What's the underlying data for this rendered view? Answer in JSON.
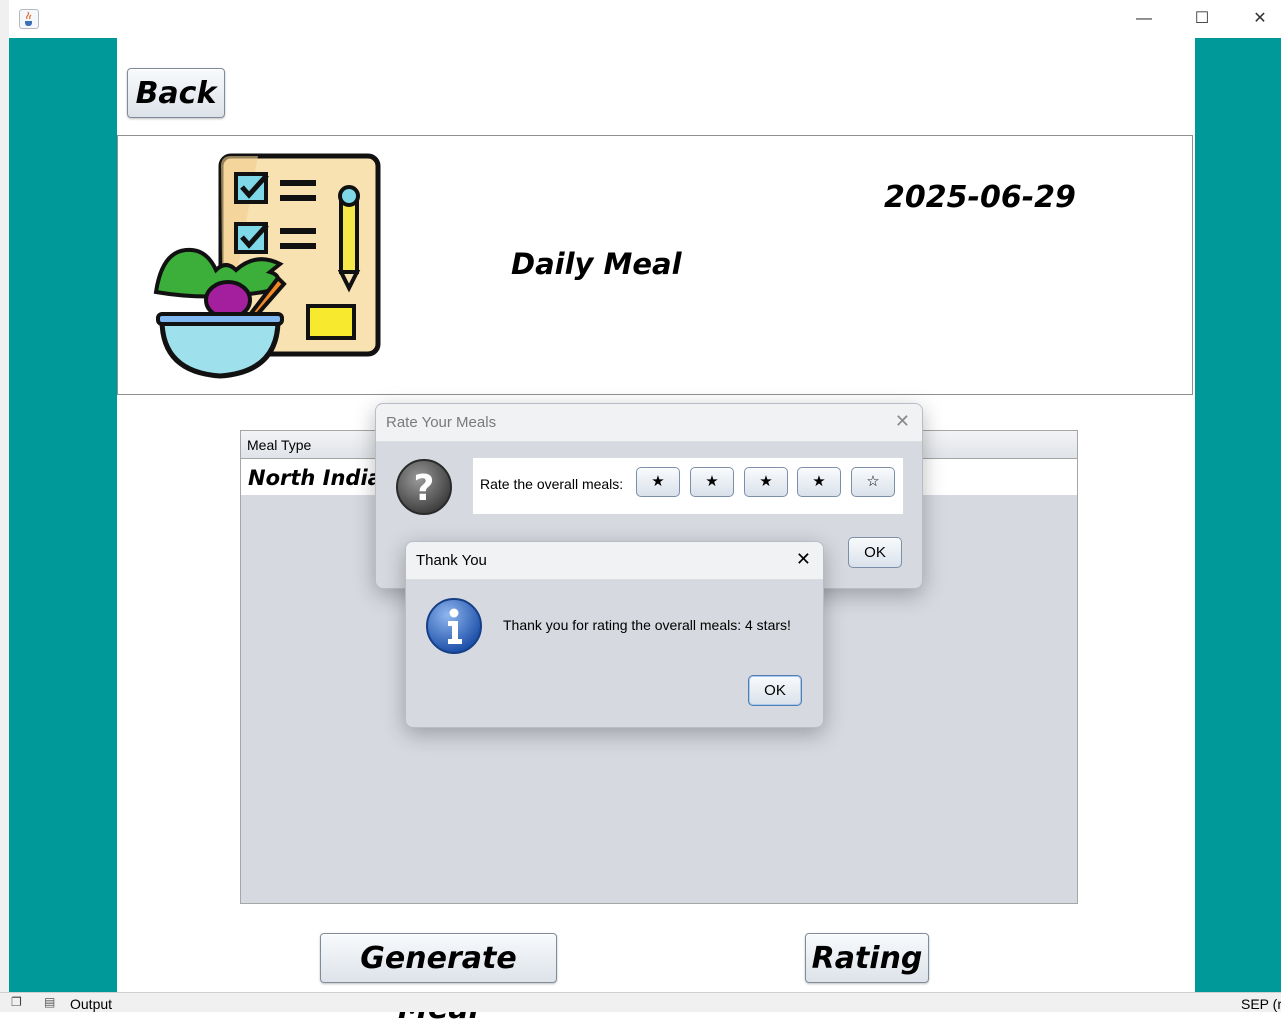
{
  "window": {
    "app_icon": "java-cup-icon",
    "controls": {
      "minimize": "—",
      "maximize": "☐",
      "close": "✕"
    }
  },
  "main": {
    "back_label": "Back",
    "title": "Daily Meal",
    "date": "2025-06-29",
    "logo_icon": "meal-checklist-icon",
    "table": {
      "columns": [
        "Meal Type"
      ],
      "rows": [
        [
          "North Indian"
        ]
      ]
    },
    "generate_label": "Generate Meal",
    "rating_label": "Rating"
  },
  "rate_dialog": {
    "title": "Rate Your Meals",
    "close": "✕",
    "icon": "question-icon",
    "prompt": "Rate the overall meals:",
    "stars": [
      "★",
      "★",
      "★",
      "★",
      "☆"
    ],
    "ok_label": "OK"
  },
  "thanks_dialog": {
    "title": "Thank You",
    "close": "✕",
    "icon": "info-icon",
    "message": "Thank you for rating the overall meals: 4 stars!",
    "ok_label": "OK"
  },
  "status_bar": {
    "output_label": "Output",
    "right_text": "SEP (r"
  },
  "colors": {
    "frame_teal": "#009999",
    "dialog_bg": "#d6d9e0"
  }
}
